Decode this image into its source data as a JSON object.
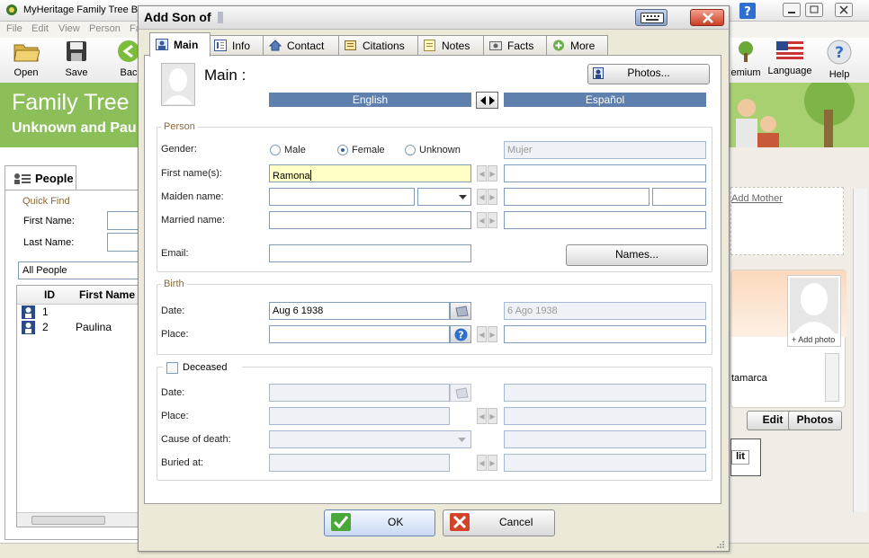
{
  "app": {
    "title": "MyHeritage Family Tree Bu",
    "menu": [
      "File",
      "Edit",
      "View",
      "Person",
      "Fa"
    ],
    "toolbar": {
      "open": "Open",
      "save": "Save",
      "back": "Bac",
      "premium": "emium",
      "language": "Language",
      "help": "Help"
    },
    "banner": {
      "title": "Family Tree",
      "subtitle": "Unknown and Pau"
    },
    "people_tab": "People",
    "quick_find": {
      "label": "Quick Find",
      "first_name": "First Name:",
      "last_name": "Last Name:"
    },
    "filter": "All People",
    "grid": {
      "columns": [
        "ID",
        "First Name"
      ],
      "rows": [
        {
          "id": "1",
          "first_name": ""
        },
        {
          "id": "2",
          "first_name": "Paulina"
        }
      ]
    },
    "right_panel": {
      "add_mother": "Add Mother",
      "add_photo": "+ Add photo",
      "place_fragment": "tamarca",
      "edit": "Edit",
      "photos": "Photos",
      "edit_fragment": "lit"
    }
  },
  "dialog": {
    "title": "Add Son of",
    "tabs": [
      "Main",
      "Info",
      "Contact",
      "Citations",
      "Notes",
      "Facts",
      "More"
    ],
    "active_tab": "Main",
    "heading": "Main :",
    "photos_button": "Photos...",
    "languages": {
      "left": "English",
      "right": "Español"
    },
    "person": {
      "group": "Person",
      "gender_label": "Gender:",
      "gender_options": [
        "Male",
        "Female",
        "Unknown"
      ],
      "gender_selected": "Female",
      "gender_translation": "Mujer",
      "first_names_label": "First name(s):",
      "first_names_value": "Ramona",
      "maiden_label": "Maiden name:",
      "married_label": "Married name:",
      "email_label": "Email:",
      "names_button": "Names..."
    },
    "birth": {
      "group": "Birth",
      "date_label": "Date:",
      "date_value": "Aug 6 1938",
      "date_translation": "6 Ago 1938",
      "place_label": "Place:"
    },
    "death": {
      "deceased_label": "Deceased",
      "date_label": "Date:",
      "place_label": "Place:",
      "cause_label": "Cause of death:",
      "buried_label": "Buried at:"
    },
    "ok": "OK",
    "cancel": "Cancel"
  }
}
